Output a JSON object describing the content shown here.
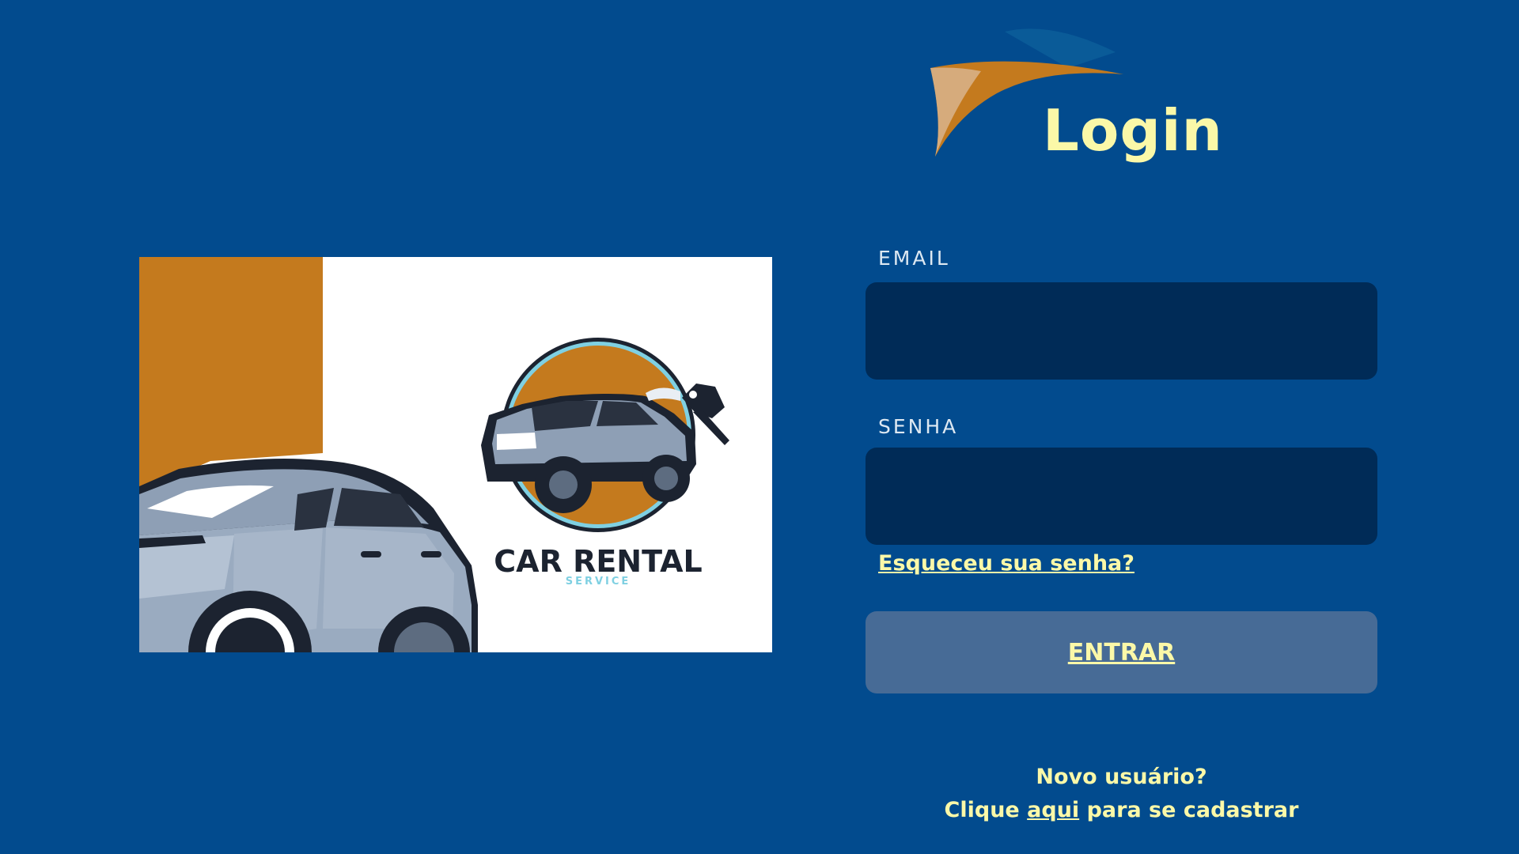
{
  "header": {
    "title": "Login"
  },
  "hero": {
    "logo_title": "CAR RENTAL",
    "logo_subtitle": "SERVICE",
    "icons": [
      "car-illustration",
      "car-key-icon",
      "car-rental-logo"
    ]
  },
  "form": {
    "email": {
      "label": "EMAIL",
      "value": "",
      "placeholder": ""
    },
    "password": {
      "label": "SENHA",
      "value": "",
      "placeholder": ""
    },
    "forgot_label": "Esqueceu sua senha?",
    "submit_label": "ENTRAR"
  },
  "signup": {
    "line1": "Novo usuário?",
    "prefix": "Clique",
    "link_label": "aqui",
    "suffix": "para se cadastrar"
  },
  "colors": {
    "background": "#024b8e",
    "accent_yellow": "#fbf8a8",
    "accent_orange": "#c47a1e",
    "input_background": "#002b57",
    "button_background": "#476b96",
    "label_color": "#dde8f2"
  }
}
